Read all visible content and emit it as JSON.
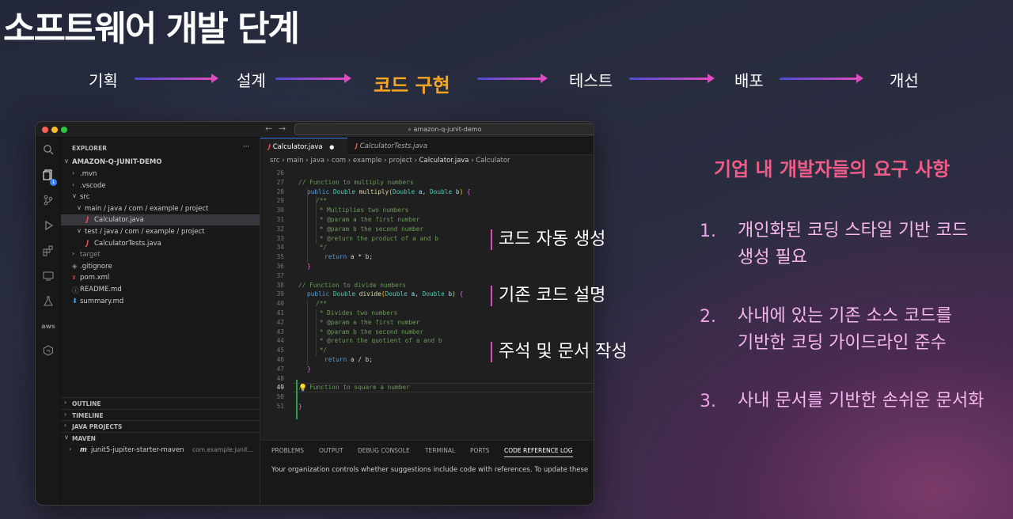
{
  "slide": {
    "title": "소프트웨어 개발 단계",
    "stages": [
      "기획",
      "설계",
      "코드 구현",
      "테스트",
      "배포",
      "개선"
    ],
    "active_stage": "코드 구현",
    "callouts": [
      "코드 자동 생성",
      "기존 코드 설명",
      "주석 및 문서 작성"
    ],
    "requirements_title": "기업 내 개발자들의 요구 사항",
    "requirements": [
      {
        "num": "1.",
        "line1": "개인화된 코딩 스타일 기반 코드",
        "line2": "생성 필요"
      },
      {
        "num": "2.",
        "line1": "사내에 있는 기존 소스 코드를",
        "line2": "기반한 코딩 가이드라인 준수"
      },
      {
        "num": "3.",
        "line1": "사내 문서를 기반한 손쉬운 문서화",
        "line2": ""
      }
    ]
  },
  "vscode": {
    "window_title": "amazon-q-junit-demo",
    "nav_back": "←",
    "nav_forward": "→",
    "explorer_label": "EXPLORER",
    "explorer_more": "···",
    "project_root": "AMAZON-Q-JUNIT-DEMO",
    "tree": [
      {
        "label": ".mvn",
        "type": "folder",
        "indent": 1,
        "expanded": false
      },
      {
        "label": ".vscode",
        "type": "folder",
        "indent": 1,
        "expanded": false
      },
      {
        "label": "src",
        "type": "folder",
        "indent": 1,
        "expanded": true
      },
      {
        "label": "main / java / com / example / project",
        "type": "folder",
        "indent": 2,
        "expanded": true
      },
      {
        "label": "Calculator.java",
        "type": "java",
        "indent": 3,
        "selected": true
      },
      {
        "label": "test / java / com / example / project",
        "type": "folder",
        "indent": 2,
        "expanded": true
      },
      {
        "label": "CalculatorTests.java",
        "type": "java",
        "indent": 3
      },
      {
        "label": "target",
        "type": "folder-muted",
        "indent": 1,
        "expanded": false
      },
      {
        "label": ".gitignore",
        "type": "git",
        "indent": 1
      },
      {
        "label": "pom.xml",
        "type": "xml",
        "indent": 1
      },
      {
        "label": "README.md",
        "type": "md-info",
        "indent": 1
      },
      {
        "label": "summary.md",
        "type": "md-down",
        "indent": 1
      }
    ],
    "sections": [
      "OUTLINE",
      "TIMELINE",
      "JAVA PROJECTS",
      "MAVEN"
    ],
    "maven_item": "junit5-jupiter-starter-maven",
    "maven_item_detail": "com.example:junit...",
    "activity_badge": "1",
    "tabs": [
      {
        "label": "Calculator.java",
        "modified_dot": "●"
      },
      {
        "label": "CalculatorTests.java"
      }
    ],
    "breadcrumb": [
      "src",
      "main",
      "java",
      "com",
      "example",
      "project",
      "Calculator.java",
      "Calculator"
    ],
    "lightbulb": "💡",
    "panel_tabs": [
      "PROBLEMS",
      "OUTPUT",
      "DEBUG CONSOLE",
      "TERMINAL",
      "PORTS",
      "CODE REFERENCE LOG"
    ],
    "panel_active": "CODE REFERENCE LOG",
    "panel_message": "Your organization controls whether suggestions include code with references. To update these",
    "code_lines": [
      {
        "n": "26",
        "t": ""
      },
      {
        "n": "27",
        "t": "// Function to multiply numbers"
      },
      {
        "n": "28",
        "t": "public Double multiply(Double a, Double b) {"
      },
      {
        "n": "29",
        "t": "/**"
      },
      {
        "n": "30",
        "t": " * Multiplies two numbers"
      },
      {
        "n": "31",
        "t": " * @param a the first number"
      },
      {
        "n": "32",
        "t": " * @param b the second number"
      },
      {
        "n": "33",
        "t": " * @return the product of a and b"
      },
      {
        "n": "34",
        "t": " */"
      },
      {
        "n": "35",
        "t": "return a * b;"
      },
      {
        "n": "36",
        "t": "}"
      },
      {
        "n": "37",
        "t": ""
      },
      {
        "n": "38",
        "t": "// Function to divide numbers"
      },
      {
        "n": "39",
        "t": "public Double divide(Double a, Double b) {"
      },
      {
        "n": "40",
        "t": "/**"
      },
      {
        "n": "41",
        "t": " * Divides two numbers"
      },
      {
        "n": "42",
        "t": " * @param a the first number"
      },
      {
        "n": "43",
        "t": " * @param b the second number"
      },
      {
        "n": "44",
        "t": " * @return the quotient of a and b"
      },
      {
        "n": "45",
        "t": " */"
      },
      {
        "n": "46",
        "t": "return a / b;"
      },
      {
        "n": "47",
        "t": "}"
      },
      {
        "n": "48",
        "t": ""
      },
      {
        "n": "49",
        "t": "// Function to square a number"
      },
      {
        "n": "50",
        "t": ""
      },
      {
        "n": "51",
        "t": "}"
      }
    ]
  },
  "colors": {
    "active_stage": "#f5a623",
    "requirements_title": "#f25c88",
    "requirements_text": "#f6b8ee",
    "callout_bar": "#e04bc0"
  }
}
